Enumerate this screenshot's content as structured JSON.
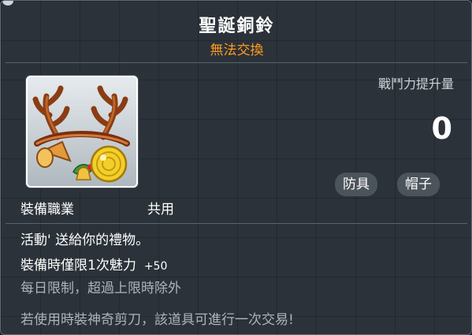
{
  "item": {
    "name": "聖誕銅鈴",
    "trade_status": "無法交換"
  },
  "stats": {
    "power_label": "戰鬥力提升量",
    "power_value": "0"
  },
  "tags": {
    "category": "防具",
    "subcategory": "帽子"
  },
  "job": {
    "label": "裝備職業",
    "value": "共用"
  },
  "description": {
    "line1": "活動' 送給你的禮物。",
    "line2_text": "裝備時僅限1次魅力",
    "line2_stat": "+50",
    "line3": "每日限制，超過上限時除外",
    "line4": "若使用時裝神奇剪刀，該道具可進行一次交易!"
  },
  "colors": {
    "trade_status": "#ff9b1f",
    "muted_text": "#aeb4b9",
    "tag_bg": "#4c545b"
  },
  "icons": {
    "item_icon": "reindeer-antler-bell-headband-icon"
  }
}
